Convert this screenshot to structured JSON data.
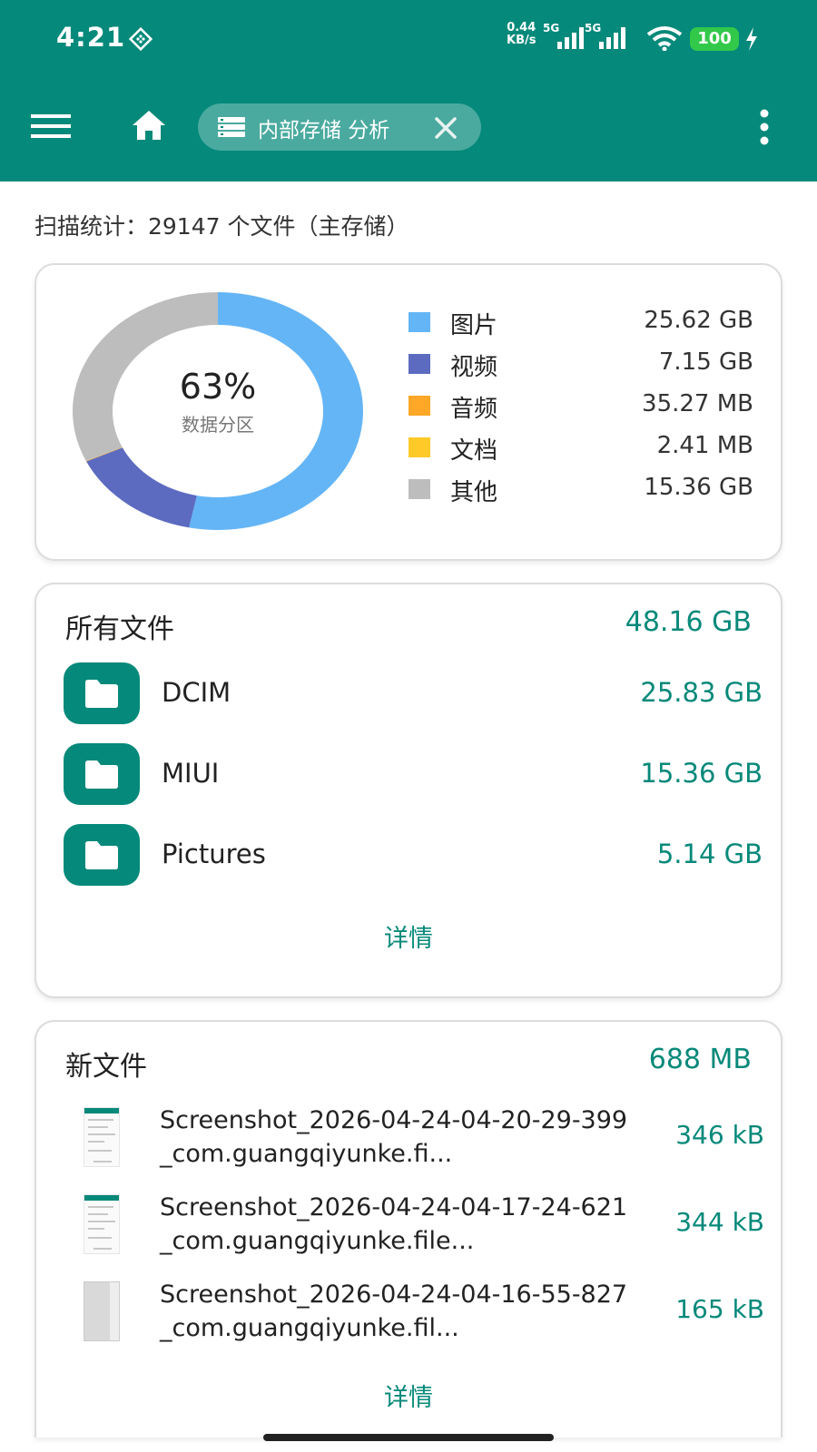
{
  "status_bar": {
    "time": "4:21",
    "net_speed_value": "0.44",
    "net_speed_unit": "KB/s",
    "sim1": "5G",
    "sim2": "5G",
    "battery": "100"
  },
  "toolbar": {
    "chip_label": "内部存储 分析"
  },
  "scan_stats": "扫描统计：29147 个文件（主存储）",
  "storage_chart": {
    "center_percent": "63%",
    "center_label": "数据分区"
  },
  "chart_data": {
    "type": "pie",
    "categories": [
      "图片",
      "视频",
      "音频",
      "文档",
      "其他"
    ],
    "values": [
      25.62,
      7.15,
      0.035,
      0.0024,
      15.36
    ],
    "colors": [
      "#64b5f6",
      "#5c6bc0",
      "#ffa726",
      "#ffca28",
      "#bdbdbd"
    ],
    "display_values": [
      "25.62 GB",
      "7.15 GB",
      "35.27 MB",
      "2.41 MB",
      "15.36 GB"
    ]
  },
  "all_files": {
    "title": "所有文件",
    "total": "48.16 GB",
    "folders": [
      {
        "name": "DCIM",
        "size": "25.83 GB"
      },
      {
        "name": "MIUI",
        "size": "15.36 GB"
      },
      {
        "name": "Pictures",
        "size": "5.14 GB"
      }
    ],
    "details_label": "详情"
  },
  "new_files": {
    "title": "新文件",
    "total": "688 MB",
    "files": [
      {
        "name": "Screenshot_2026-04-24-04-20-29-399_com.guangqiyunke.fi...",
        "size": "346 kB"
      },
      {
        "name": "Screenshot_2026-04-24-04-17-24-621_com.guangqiyunke.file...",
        "size": "344 kB"
      },
      {
        "name": "Screenshot_2026-04-24-04-16-55-827_com.guangqiyunke.fil...",
        "size": "165 kB"
      }
    ],
    "details_label": "详情"
  }
}
